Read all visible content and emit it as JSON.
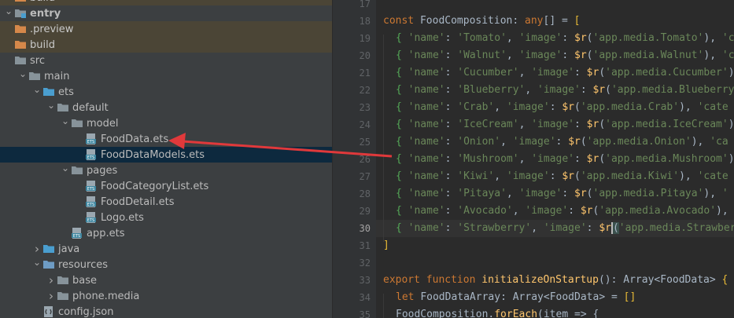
{
  "project_tree": {
    "items": [
      {
        "label": "build",
        "type": "folder",
        "color": "orange",
        "depth": 0,
        "arrow": "none"
      },
      {
        "label": "entry",
        "type": "module",
        "depth": 0,
        "arrow": "open",
        "bold": true
      },
      {
        "label": ".preview",
        "type": "folder",
        "color": "orange",
        "depth": 0,
        "arrow": "none"
      },
      {
        "label": "build",
        "type": "folder",
        "color": "orange",
        "depth": 0,
        "arrow": "none"
      },
      {
        "label": "src",
        "type": "folder",
        "depth": 0,
        "arrow": "none"
      },
      {
        "label": "main",
        "type": "folder",
        "depth": 1,
        "arrow": "open"
      },
      {
        "label": "ets",
        "type": "folder-src",
        "depth": 2,
        "arrow": "open"
      },
      {
        "label": "default",
        "type": "folder",
        "depth": 3,
        "arrow": "open"
      },
      {
        "label": "model",
        "type": "folder",
        "depth": 4,
        "arrow": "open"
      },
      {
        "label": "FoodData.ets",
        "type": "ets-file",
        "depth": 5,
        "arrow": "none"
      },
      {
        "label": "FoodDataModels.ets",
        "type": "ets-file",
        "depth": 5,
        "arrow": "none",
        "selected": true
      },
      {
        "label": "pages",
        "type": "folder",
        "depth": 4,
        "arrow": "open"
      },
      {
        "label": "FoodCategoryList.ets",
        "type": "ets-file",
        "depth": 5,
        "arrow": "none"
      },
      {
        "label": "FoodDetail.ets",
        "type": "ets-file",
        "depth": 5,
        "arrow": "none"
      },
      {
        "label": "Logo.ets",
        "type": "ets-file",
        "depth": 5,
        "arrow": "none"
      },
      {
        "label": "app.ets",
        "type": "ets-file",
        "depth": 4,
        "arrow": "none"
      },
      {
        "label": "java",
        "type": "folder-src",
        "depth": 2,
        "arrow": "closed"
      },
      {
        "label": "resources",
        "type": "folder-res",
        "depth": 2,
        "arrow": "open"
      },
      {
        "label": "base",
        "type": "folder",
        "depth": 3,
        "arrow": "closed"
      },
      {
        "label": "phone.media",
        "type": "folder",
        "depth": 3,
        "arrow": "closed"
      },
      {
        "label": "config.json",
        "type": "json-file",
        "depth": 2,
        "arrow": "none"
      }
    ]
  },
  "editor": {
    "line_numbers": [
      "17",
      "18",
      "19",
      "20",
      "21",
      "22",
      "23",
      "24",
      "25",
      "26",
      "27",
      "28",
      "29",
      "30",
      "31",
      "32",
      "33",
      "34",
      "35"
    ],
    "current_line": "30",
    "lines": [
      {
        "segments": []
      },
      {
        "segments": [
          {
            "t": "const ",
            "c": "kw"
          },
          {
            "t": "FoodComposition",
            "c": ""
          },
          {
            "t": ": ",
            "c": ""
          },
          {
            "t": "any",
            "c": "kw"
          },
          {
            "t": "[] = ",
            "c": ""
          },
          {
            "t": "[",
            "c": "br"
          }
        ]
      },
      {
        "indent": true,
        "segments": [
          {
            "t": "{ ",
            "c": "brace"
          },
          {
            "t": "'name'",
            "c": "str"
          },
          {
            "t": ": ",
            "c": ""
          },
          {
            "t": "'Tomato'",
            "c": "str"
          },
          {
            "t": ", ",
            "c": ""
          },
          {
            "t": "'image'",
            "c": "str"
          },
          {
            "t": ": ",
            "c": ""
          },
          {
            "t": "$r",
            "c": "fn"
          },
          {
            "t": "(",
            "c": ""
          },
          {
            "t": "'app.media.Tomato'",
            "c": "str"
          },
          {
            "t": "), ",
            "c": ""
          },
          {
            "t": "'cat",
            "c": "str"
          }
        ]
      },
      {
        "indent": true,
        "segments": [
          {
            "t": "{ ",
            "c": "brace"
          },
          {
            "t": "'name'",
            "c": "str"
          },
          {
            "t": ": ",
            "c": ""
          },
          {
            "t": "'Walnut'",
            "c": "str"
          },
          {
            "t": ", ",
            "c": ""
          },
          {
            "t": "'image'",
            "c": "str"
          },
          {
            "t": ": ",
            "c": ""
          },
          {
            "t": "$r",
            "c": "fn"
          },
          {
            "t": "(",
            "c": ""
          },
          {
            "t": "'app.media.Walnut'",
            "c": "str"
          },
          {
            "t": "), ",
            "c": ""
          },
          {
            "t": "'cat",
            "c": "str"
          }
        ]
      },
      {
        "indent": true,
        "segments": [
          {
            "t": "{ ",
            "c": "brace"
          },
          {
            "t": "'name'",
            "c": "str"
          },
          {
            "t": ": ",
            "c": ""
          },
          {
            "t": "'Cucumber'",
            "c": "str"
          },
          {
            "t": ", ",
            "c": ""
          },
          {
            "t": "'image'",
            "c": "str"
          },
          {
            "t": ": ",
            "c": ""
          },
          {
            "t": "$r",
            "c": "fn"
          },
          {
            "t": "(",
            "c": ""
          },
          {
            "t": "'app.media.Cucumber'",
            "c": "str"
          },
          {
            "t": "),",
            "c": ""
          }
        ]
      },
      {
        "indent": true,
        "segments": [
          {
            "t": "{ ",
            "c": "brace"
          },
          {
            "t": "'name'",
            "c": "str"
          },
          {
            "t": ": ",
            "c": ""
          },
          {
            "t": "'Blueberry'",
            "c": "str"
          },
          {
            "t": ", ",
            "c": ""
          },
          {
            "t": "'image'",
            "c": "str"
          },
          {
            "t": ": ",
            "c": ""
          },
          {
            "t": "$r",
            "c": "fn"
          },
          {
            "t": "(",
            "c": ""
          },
          {
            "t": "'app.media.Blueberry'",
            "c": "str"
          }
        ]
      },
      {
        "indent": true,
        "segments": [
          {
            "t": "{ ",
            "c": "brace"
          },
          {
            "t": "'name'",
            "c": "str"
          },
          {
            "t": ": ",
            "c": ""
          },
          {
            "t": "'Crab'",
            "c": "str"
          },
          {
            "t": ", ",
            "c": ""
          },
          {
            "t": "'image'",
            "c": "str"
          },
          {
            "t": ": ",
            "c": ""
          },
          {
            "t": "$r",
            "c": "fn"
          },
          {
            "t": "(",
            "c": ""
          },
          {
            "t": "'app.media.Crab'",
            "c": "str"
          },
          {
            "t": "), ",
            "c": ""
          },
          {
            "t": "'cate",
            "c": "str"
          }
        ]
      },
      {
        "indent": true,
        "segments": [
          {
            "t": "{ ",
            "c": "brace"
          },
          {
            "t": "'name'",
            "c": "str"
          },
          {
            "t": ": ",
            "c": ""
          },
          {
            "t": "'IceCream'",
            "c": "str"
          },
          {
            "t": ", ",
            "c": ""
          },
          {
            "t": "'image'",
            "c": "str"
          },
          {
            "t": ": ",
            "c": ""
          },
          {
            "t": "$r",
            "c": "fn"
          },
          {
            "t": "(",
            "c": ""
          },
          {
            "t": "'app.media.IceCream'",
            "c": "str"
          },
          {
            "t": "),",
            "c": ""
          }
        ]
      },
      {
        "indent": true,
        "segments": [
          {
            "t": "{ ",
            "c": "brace"
          },
          {
            "t": "'name'",
            "c": "str"
          },
          {
            "t": ": ",
            "c": ""
          },
          {
            "t": "'Onion'",
            "c": "str"
          },
          {
            "t": ", ",
            "c": ""
          },
          {
            "t": "'image'",
            "c": "str"
          },
          {
            "t": ": ",
            "c": ""
          },
          {
            "t": "$r",
            "c": "fn"
          },
          {
            "t": "(",
            "c": ""
          },
          {
            "t": "'app.media.Onion'",
            "c": "str"
          },
          {
            "t": "), ",
            "c": ""
          },
          {
            "t": "'ca",
            "c": "str"
          }
        ]
      },
      {
        "indent": true,
        "segments": [
          {
            "t": "{ ",
            "c": "brace"
          },
          {
            "t": "'name'",
            "c": "str"
          },
          {
            "t": ": ",
            "c": ""
          },
          {
            "t": "'Mushroom'",
            "c": "str"
          },
          {
            "t": ", ",
            "c": ""
          },
          {
            "t": "'image'",
            "c": "str"
          },
          {
            "t": ": ",
            "c": ""
          },
          {
            "t": "$r",
            "c": "fn"
          },
          {
            "t": "(",
            "c": ""
          },
          {
            "t": "'app.media.Mushroom'",
            "c": "str"
          },
          {
            "t": "),",
            "c": ""
          }
        ]
      },
      {
        "indent": true,
        "segments": [
          {
            "t": "{ ",
            "c": "brace"
          },
          {
            "t": "'name'",
            "c": "str"
          },
          {
            "t": ": ",
            "c": ""
          },
          {
            "t": "'Kiwi'",
            "c": "str"
          },
          {
            "t": ", ",
            "c": ""
          },
          {
            "t": "'image'",
            "c": "str"
          },
          {
            "t": ": ",
            "c": ""
          },
          {
            "t": "$r",
            "c": "fn"
          },
          {
            "t": "(",
            "c": ""
          },
          {
            "t": "'app.media.Kiwi'",
            "c": "str"
          },
          {
            "t": "), ",
            "c": ""
          },
          {
            "t": "'cate",
            "c": "str"
          }
        ]
      },
      {
        "indent": true,
        "segments": [
          {
            "t": "{ ",
            "c": "brace"
          },
          {
            "t": "'name'",
            "c": "str"
          },
          {
            "t": ": ",
            "c": ""
          },
          {
            "t": "'Pitaya'",
            "c": "str"
          },
          {
            "t": ", ",
            "c": ""
          },
          {
            "t": "'image'",
            "c": "str"
          },
          {
            "t": ": ",
            "c": ""
          },
          {
            "t": "$r",
            "c": "fn"
          },
          {
            "t": "(",
            "c": ""
          },
          {
            "t": "'app.media.Pitaya'",
            "c": "str"
          },
          {
            "t": "), ",
            "c": ""
          },
          {
            "t": "'",
            "c": "str"
          }
        ]
      },
      {
        "indent": true,
        "segments": [
          {
            "t": "{ ",
            "c": "brace"
          },
          {
            "t": "'name'",
            "c": "str"
          },
          {
            "t": ": ",
            "c": ""
          },
          {
            "t": "'Avocado'",
            "c": "str"
          },
          {
            "t": ", ",
            "c": ""
          },
          {
            "t": "'image'",
            "c": "str"
          },
          {
            "t": ": ",
            "c": ""
          },
          {
            "t": "$r",
            "c": "fn"
          },
          {
            "t": "(",
            "c": ""
          },
          {
            "t": "'app.media.Avocado'",
            "c": "str"
          },
          {
            "t": "), ",
            "c": ""
          }
        ]
      },
      {
        "indent": true,
        "segments": [
          {
            "t": "{ ",
            "c": "brace"
          },
          {
            "t": "'name'",
            "c": "str"
          },
          {
            "t": ": ",
            "c": ""
          },
          {
            "t": "'Strawberry'",
            "c": "str"
          },
          {
            "t": ", ",
            "c": ""
          },
          {
            "t": "'image'",
            "c": "str"
          },
          {
            "t": ": ",
            "c": ""
          },
          {
            "t": "$r",
            "c": "fn"
          },
          {
            "t": "(",
            "c": "match caret"
          },
          {
            "t": "'app.media.Strawberry'",
            "c": "str"
          }
        ]
      },
      {
        "segments": [
          {
            "t": "]",
            "c": "br"
          }
        ]
      },
      {
        "segments": []
      },
      {
        "segments": [
          {
            "t": "export ",
            "c": "kw"
          },
          {
            "t": "function ",
            "c": "kw"
          },
          {
            "t": "initializeOnStartup",
            "c": "fn"
          },
          {
            "t": "(): ",
            "c": ""
          },
          {
            "t": "Array",
            "c": ""
          },
          {
            "t": "<",
            "c": ""
          },
          {
            "t": "FoodData",
            "c": ""
          },
          {
            "t": "> ",
            "c": ""
          },
          {
            "t": "{",
            "c": "br"
          }
        ]
      },
      {
        "indent": true,
        "segments": [
          {
            "t": "let ",
            "c": "kw"
          },
          {
            "t": "FoodDataArray",
            "c": ""
          },
          {
            "t": ": ",
            "c": ""
          },
          {
            "t": "Array",
            "c": ""
          },
          {
            "t": "<",
            "c": ""
          },
          {
            "t": "FoodData",
            "c": ""
          },
          {
            "t": "> = ",
            "c": ""
          },
          {
            "t": "[]",
            "c": "br"
          }
        ]
      },
      {
        "indent": true,
        "segments": [
          {
            "t": "FoodComposition",
            "c": ""
          },
          {
            "t": ".",
            "c": ""
          },
          {
            "t": "forEach",
            "c": "fn"
          },
          {
            "t": "(item => {",
            "c": ""
          }
        ]
      }
    ]
  },
  "colors": {
    "tree_bg": "#3c3f41",
    "editor_bg": "#2b2b2b",
    "selection": "#0d293e",
    "annotation_arrow": "#e0393b"
  }
}
